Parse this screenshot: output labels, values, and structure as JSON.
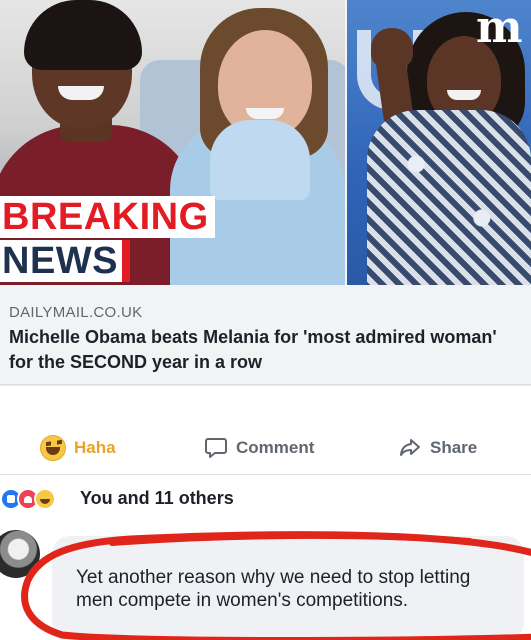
{
  "image": {
    "breaking_label": "BREAKING",
    "news_label": "NEWS",
    "logo_text": "m",
    "colors": {
      "breaking_red": "#e31b23",
      "news_navy": "#1e3250"
    }
  },
  "link": {
    "domain": "DAILYMAIL.CO.UK",
    "title": "Michelle Obama beats Melania for 'most admired woman' for the SECOND year in a row"
  },
  "actions": {
    "haha": "Haha",
    "comment": "Comment",
    "share": "Share",
    "haha_color": "#e7a42a"
  },
  "reactions": {
    "icons": [
      "like-icon",
      "love-icon",
      "haha-icon"
    ],
    "summary": "You and 11 others"
  },
  "comment": {
    "text": "Yet another reason why we need to stop letting men compete in women's competitions.",
    "annotation_color": "#e0261b"
  }
}
